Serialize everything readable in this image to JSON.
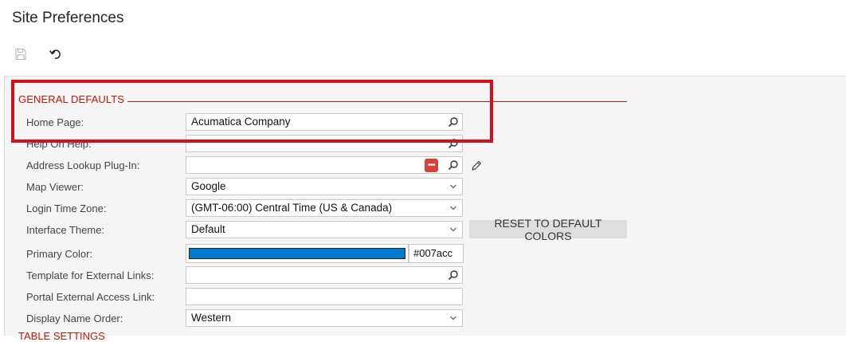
{
  "page": {
    "title": "Site Preferences"
  },
  "toolbar": {
    "save_icon": "save-icon",
    "undo_icon": "undo-icon"
  },
  "section": {
    "general_defaults": "GENERAL DEFAULTS",
    "table_settings": "TABLE SETTINGS"
  },
  "fields": {
    "home_page": {
      "label": "Home Page:",
      "value": "Acumatica Company",
      "icon": "search-icon"
    },
    "help_on_help": {
      "label": "Help On Help:",
      "value": "",
      "icon": "search-icon"
    },
    "address_lookup": {
      "label": "Address Lookup Plug-In:",
      "value": "",
      "badge": "•••",
      "icon": "search-icon",
      "edit_icon": "pencil-icon"
    },
    "map_viewer": {
      "label": "Map Viewer:",
      "value": "Google"
    },
    "login_time_zone": {
      "label": "Login Time Zone:",
      "value": "(GMT-06:00) Central Time (US & Canada)"
    },
    "interface_theme": {
      "label": "Interface Theme:",
      "value": "Default",
      "reset_button": "RESET TO DEFAULT COLORS"
    },
    "primary_color": {
      "label": "Primary Color:",
      "swatch": "#007acc",
      "hex": "#007acc"
    },
    "template_external_links": {
      "label": "Template for External Links:",
      "value": "",
      "icon": "search-icon"
    },
    "portal_external_access": {
      "label": "Portal External Access Link:",
      "value": ""
    },
    "display_name_order": {
      "label": "Display Name Order:",
      "value": "Western"
    }
  },
  "colors": {
    "accent": "#c41600",
    "highlight": "#d4101e"
  }
}
